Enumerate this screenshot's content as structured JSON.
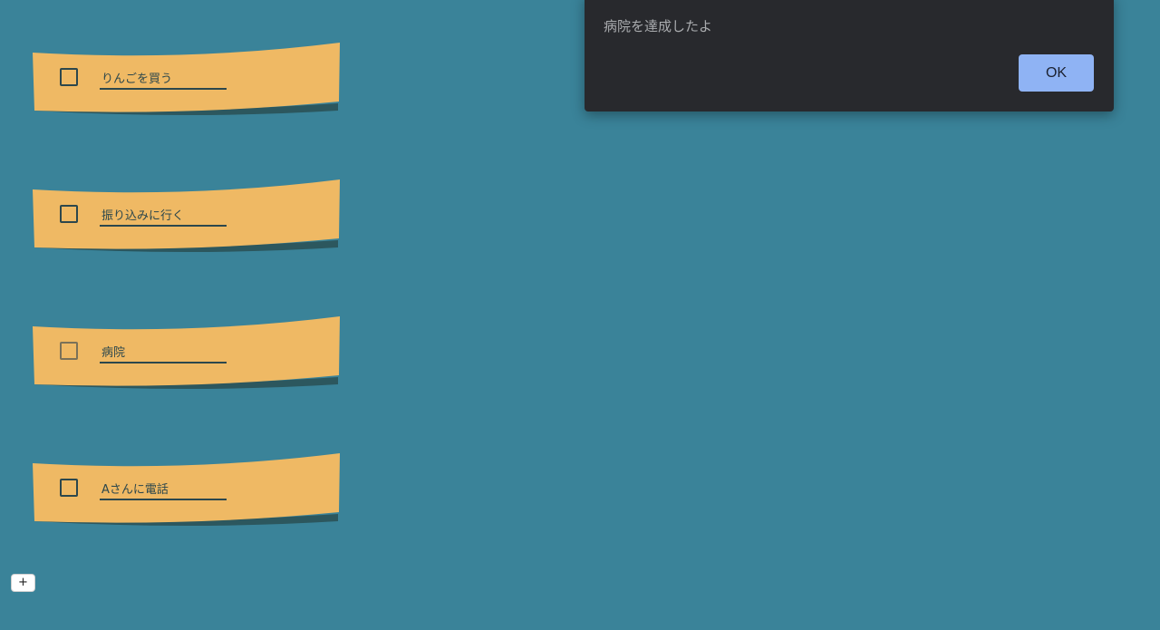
{
  "colors": {
    "background": "#3a8399",
    "note_paper": "#efb964",
    "note_shadow": "#2c575e",
    "ink": "#2c474c",
    "dialog_bg": "#28292d",
    "dialog_text": "#a9abae",
    "ok_button": "#8fb3f4"
  },
  "tasks": [
    {
      "label": "りんごを買う",
      "checked": false
    },
    {
      "label": "振り込みに行く",
      "checked": false
    },
    {
      "label": "病院",
      "checked": false
    },
    {
      "label": "Aさんに電話",
      "checked": false
    }
  ],
  "add_button": {
    "label": "+"
  },
  "dialog": {
    "message": "病院を達成したよ",
    "ok_label": "OK"
  }
}
